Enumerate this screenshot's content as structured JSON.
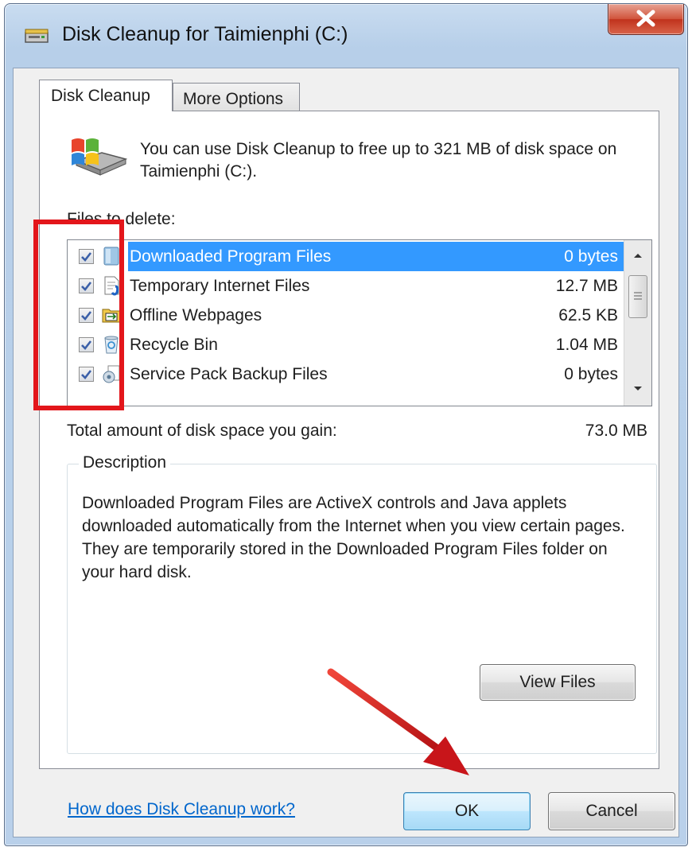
{
  "window": {
    "title": "Disk Cleanup for Taimienphi (C:)",
    "close_label": "X"
  },
  "tabs": [
    {
      "label": "Disk Cleanup",
      "active": true
    },
    {
      "label": "More Options",
      "active": false
    }
  ],
  "intro_text": "You can use Disk Cleanup to free up to 321 MB of disk space on Taimienphi (C:).",
  "files_label": "Files to delete:",
  "files": [
    {
      "name": "Downloaded Program Files",
      "size": "0 bytes",
      "checked": true,
      "selected": true,
      "icon": "folder-icon"
    },
    {
      "name": "Temporary Internet Files",
      "size": "12.7 MB",
      "checked": true,
      "selected": false,
      "icon": "document-icon"
    },
    {
      "name": "Offline Webpages",
      "size": "62.5 KB",
      "checked": true,
      "selected": false,
      "icon": "offline-webpages-icon"
    },
    {
      "name": "Recycle Bin",
      "size": "1.04 MB",
      "checked": true,
      "selected": false,
      "icon": "recycle-bin-icon"
    },
    {
      "name": "Service Pack Backup Files",
      "size": "0 bytes",
      "checked": true,
      "selected": false,
      "icon": "backup-icon"
    }
  ],
  "total": {
    "label": "Total amount of disk space you gain:",
    "value": "73.0 MB"
  },
  "description": {
    "legend": "Description",
    "text": "Downloaded Program Files are ActiveX controls and Java applets downloaded automatically from the Internet when you view certain pages. They are temporarily stored in the Downloaded Program Files folder on your hard disk."
  },
  "buttons": {
    "view_files": "View Files",
    "ok": "OK",
    "cancel": "Cancel"
  },
  "help_link": "How does Disk Cleanup work?",
  "colors": {
    "selection": "#3399ff",
    "annotation": "#e3161b",
    "link": "#0066cc"
  }
}
